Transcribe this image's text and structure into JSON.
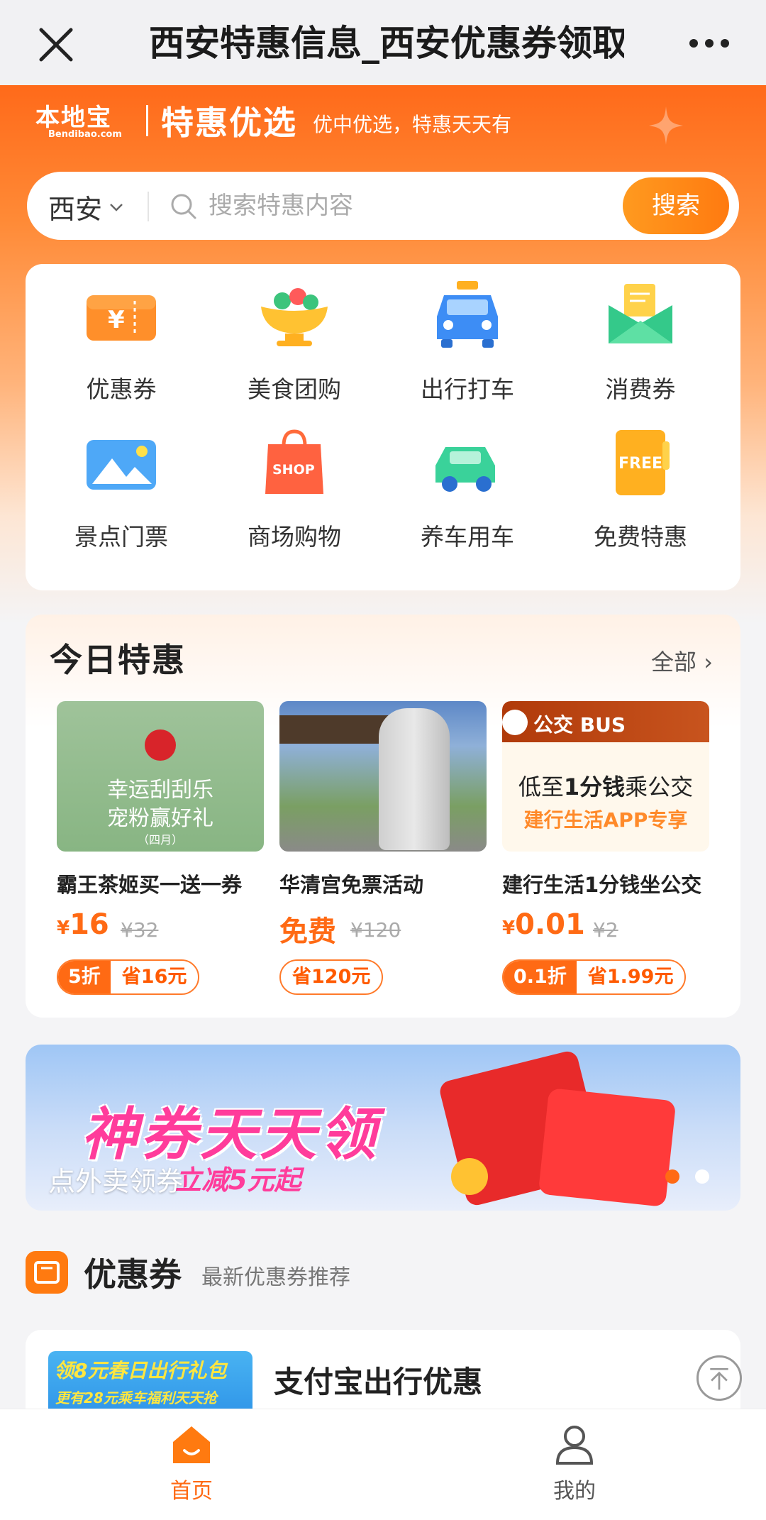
{
  "titlebar": {
    "title": "西安特惠信息_西安优惠券领取"
  },
  "brand": {
    "logo_cn": "本地宝",
    "logo_en": "Bendibao.com",
    "name": "特惠优选",
    "slogan": "优中优选，特惠天天有"
  },
  "search": {
    "city": "西安",
    "placeholder": "搜索特惠内容",
    "button": "搜索"
  },
  "categories": [
    {
      "label": "优惠券",
      "icon": "coupon-ticket-icon"
    },
    {
      "label": "美食团购",
      "icon": "food-bowl-icon"
    },
    {
      "label": "出行打车",
      "icon": "taxi-icon"
    },
    {
      "label": "消费券",
      "icon": "envelope-voucher-icon"
    },
    {
      "label": "景点门票",
      "icon": "scenery-ticket-icon"
    },
    {
      "label": "商场购物",
      "icon": "shopping-bag-icon"
    },
    {
      "label": "养车用车",
      "icon": "car-icon"
    },
    {
      "label": "免费特惠",
      "icon": "free-book-icon"
    }
  ],
  "deals": {
    "title": "今日特惠",
    "all_link": "全部",
    "items": [
      {
        "name": "霸王茶姬买一送一券",
        "currency": "¥",
        "price": "16",
        "orig": "¥32",
        "tag1": "5折",
        "tag2": "省16元",
        "img_line1": "幸运刮刮乐",
        "img_line2": "宠粉赢好礼",
        "img_line3": "（四月）"
      },
      {
        "name": "华清宫免票活动",
        "price": "免费",
        "orig": "¥120",
        "tag2": "省120元"
      },
      {
        "name": "建行生活1分钱坐公交",
        "currency": "¥",
        "price": "0.01",
        "orig": "¥2",
        "tag1": "0.1折",
        "tag2": "省1.99元",
        "img_header": "公交 BUS",
        "img_line1a": "低至",
        "img_line1b": "1分钱",
        "img_line1c": "乘公交",
        "img_line2": "建行生活APP专享"
      }
    ]
  },
  "banner": {
    "big_text": "神券天天领",
    "sub_text": "立减5元起",
    "caption": "点外卖领券",
    "dot_active": "#ff6a14"
  },
  "coupons": {
    "title": "优惠券",
    "subtitle": "最新优惠券推荐",
    "first": {
      "title": "支付宝出行优惠",
      "thumb_line1": "领8元春日出行礼包",
      "thumb_line2": "更有28元乘车福利天天抢"
    }
  },
  "tabs": [
    {
      "label": "首页",
      "active": true
    },
    {
      "label": "我的",
      "active": false
    }
  ],
  "colors": {
    "accent": "#ff6a14",
    "hero_top": "#ff6a1a"
  }
}
